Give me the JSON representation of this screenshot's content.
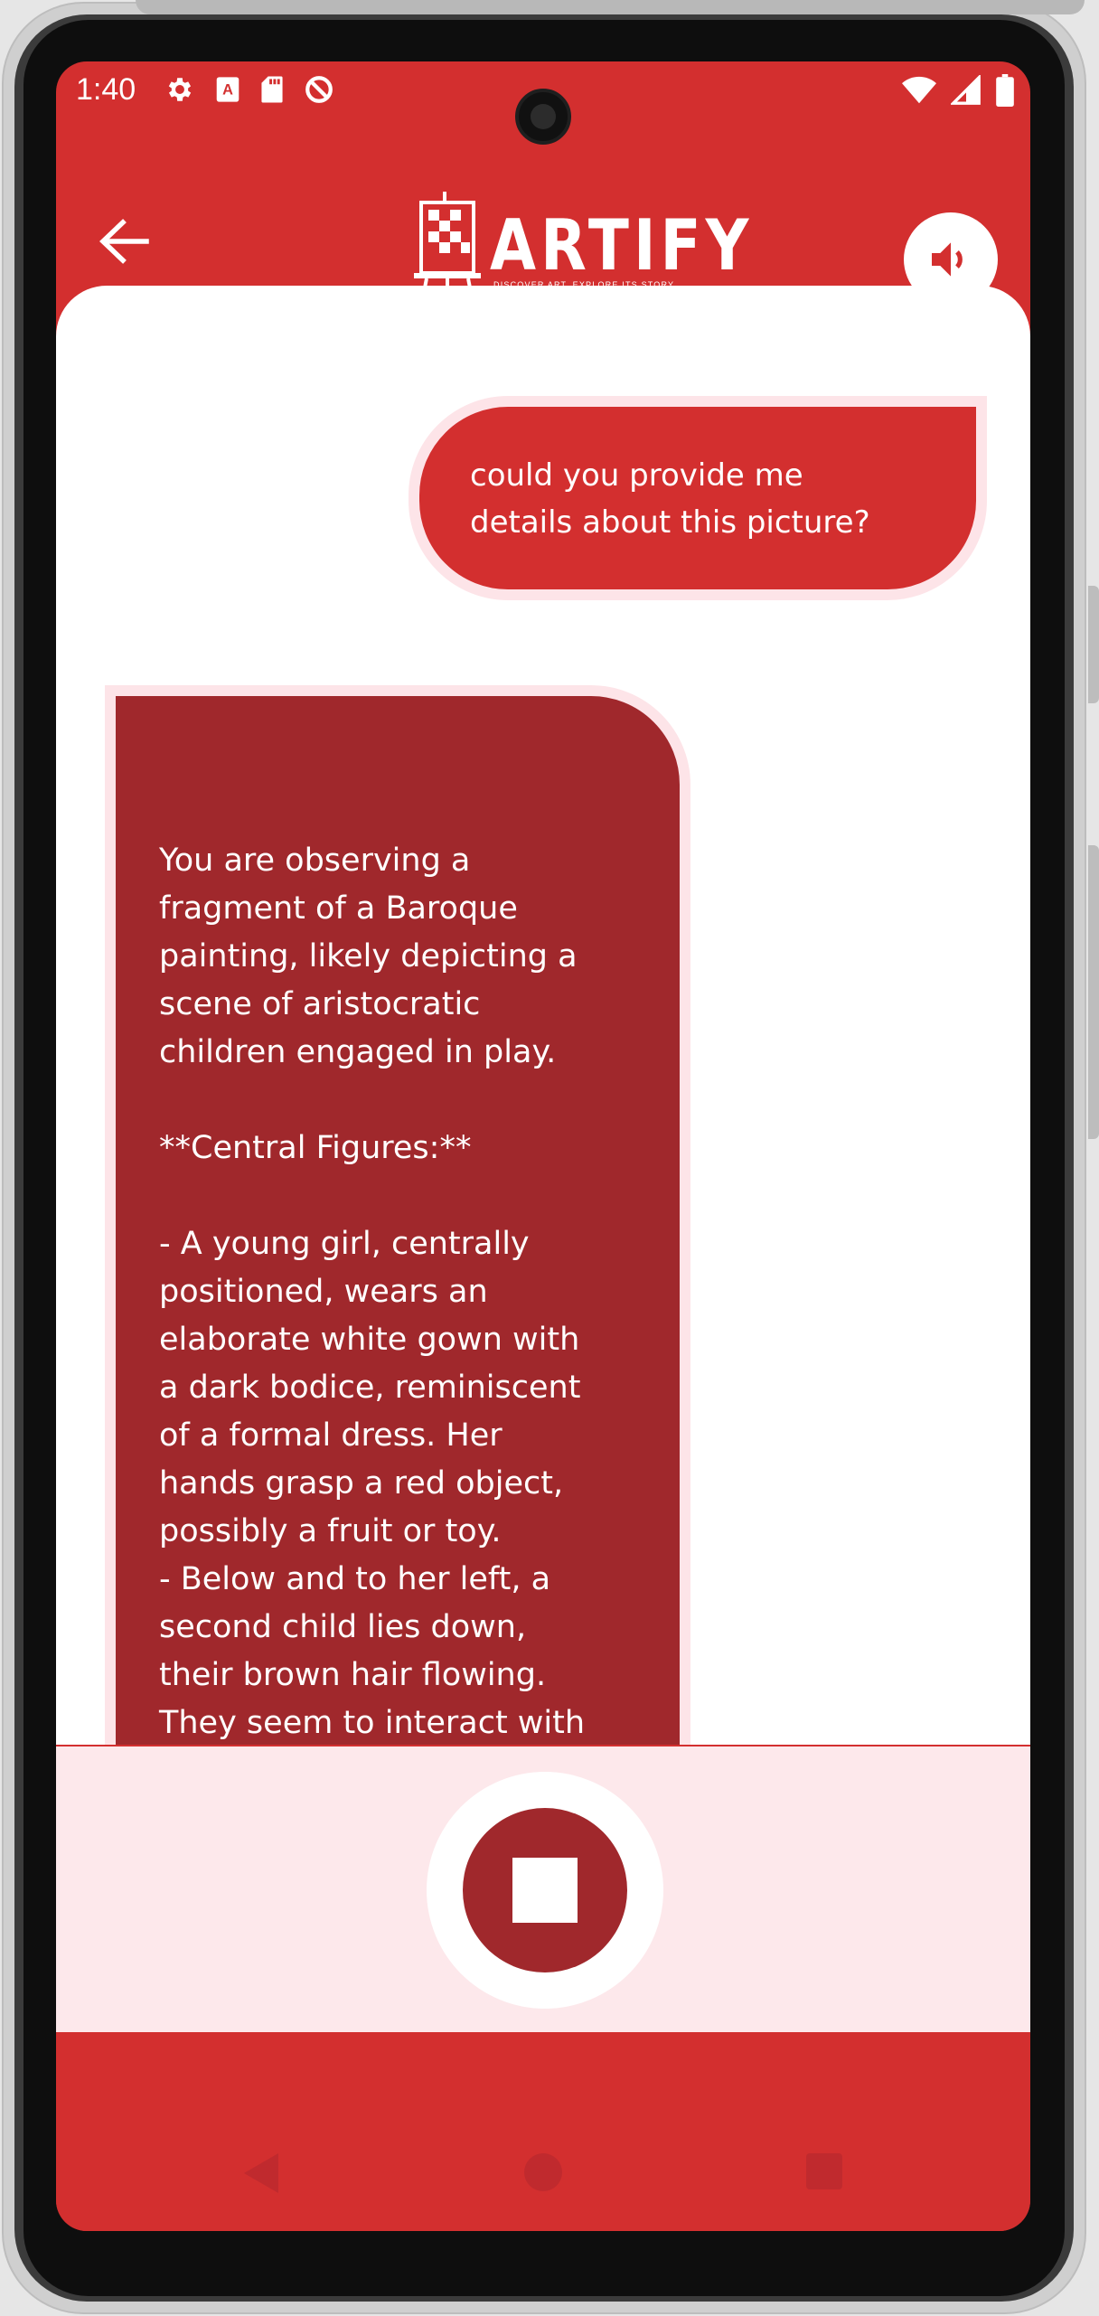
{
  "status_bar": {
    "time": "1:40",
    "left_icons": [
      "settings-icon",
      "keyboard-a-icon",
      "sd-card-icon",
      "do-not-disturb-icon"
    ],
    "right_icons": [
      "wifi-icon",
      "signal-icon",
      "battery-icon"
    ]
  },
  "header": {
    "logo_text": "ARTIFY",
    "logo_tagline": "DISCOVER ART. EXPLORE ITS STORY.",
    "back_icon": "arrow-left-icon",
    "sound_icon": "speaker-icon"
  },
  "chat": {
    "messages": [
      {
        "role": "user",
        "text": "could you provide me\ndetails about this picture?"
      },
      {
        "role": "assistant",
        "text": "You are observing a\nfragment of a Baroque\npainting, likely depicting a\nscene of aristocratic\nchildren engaged in play.\n\n**Central Figures:**\n\n- A young girl, centrally\npositioned, wears an\nelaborate white gown with\na dark bodice, reminiscent\nof a formal dress. Her\nhands grasp a red object,\npossibly a fruit or toy.\n- Below and to her left, a\nsecond child lies down,\ntheir brown hair flowing.\nThey seem to interact with\nthe girl.\n- A third child, partially"
      }
    ]
  },
  "controls": {
    "stop_icon": "stop-icon"
  },
  "nav_bar": {
    "icons": [
      "nav-back-icon",
      "nav-home-icon",
      "nav-recents-icon"
    ]
  },
  "colors": {
    "primary": "#d32f2f",
    "bot_bubble": "#a0282c",
    "bubble_outline": "#fde4e8",
    "panel": "#fde8eb"
  }
}
